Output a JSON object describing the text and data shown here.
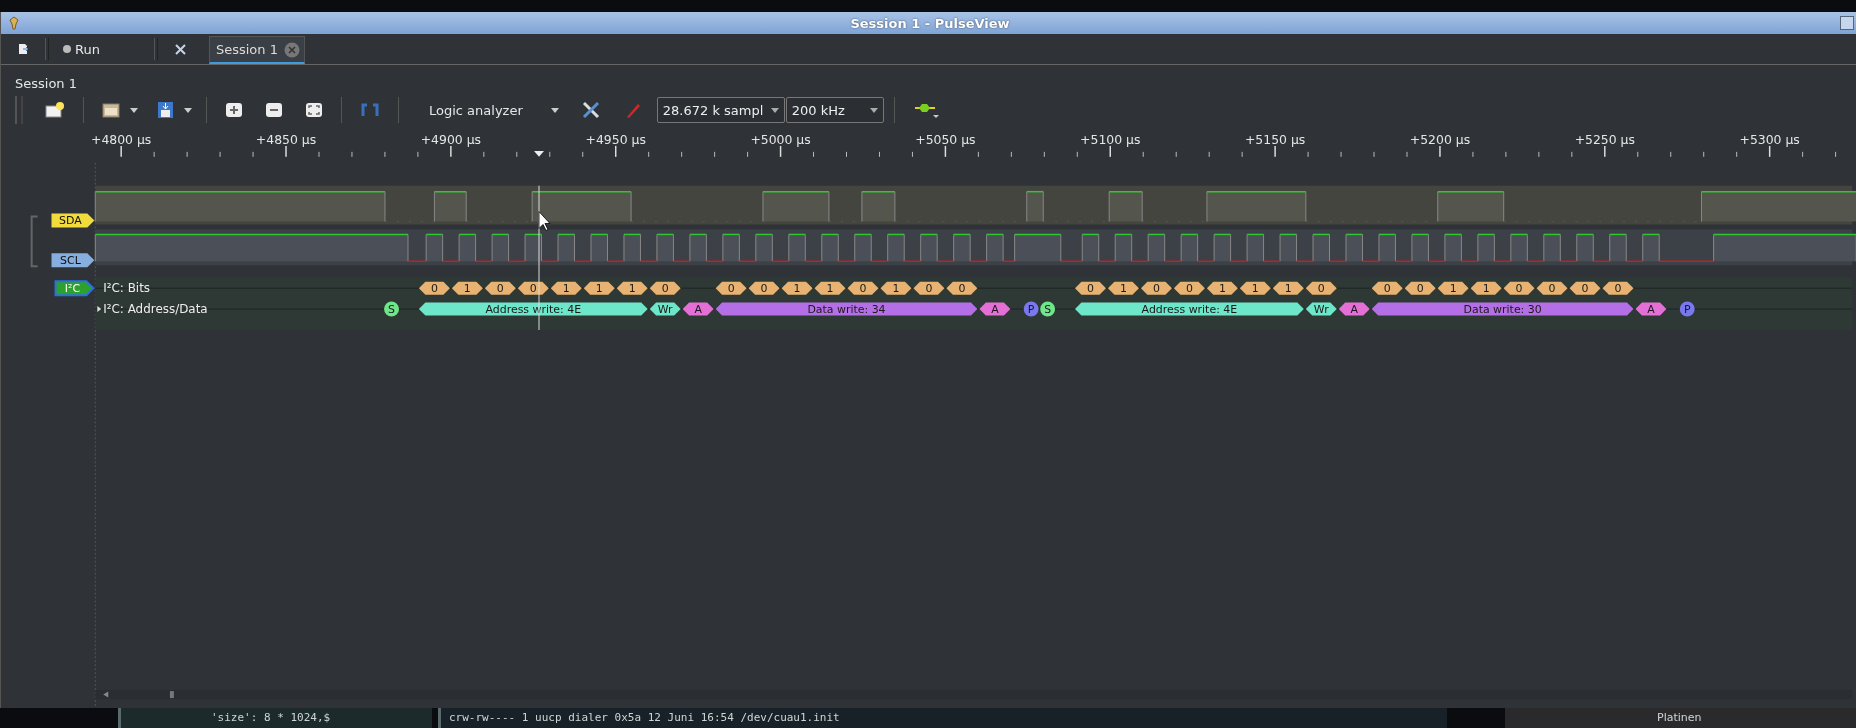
{
  "window": {
    "title": "Session 1 - PulseView"
  },
  "main_bar": {
    "run_label": "Run"
  },
  "tabs": [
    {
      "label": "Session 1",
      "selected": true
    }
  ],
  "session_label": "Session 1",
  "toolbar": {
    "device": "Logic analyzer",
    "samples": "28.672 k sampl",
    "rate": "200 kHz"
  },
  "ruler": {
    "labels": [
      "+4800 µs",
      "+4850 µs",
      "+4900 µs",
      "+4950 µs",
      "+5000 µs",
      "+5050 µs",
      "+5100 µs",
      "+5150 µs",
      "+5200 µs",
      "+5250 µs",
      "+5300 µs"
    ]
  },
  "traces": [
    {
      "name": "SDA",
      "color": "#f2dc3c"
    },
    {
      "name": "SCL",
      "color": "#86aede"
    }
  ],
  "decoder": {
    "name": "I²C",
    "rows": [
      {
        "label": "I²C: Bits",
        "expandable": false,
        "annotations": [
          {
            "text": "0",
            "kind": "bit"
          },
          {
            "text": "1",
            "kind": "bit"
          },
          {
            "text": "0",
            "kind": "bit"
          },
          {
            "text": "0",
            "kind": "bit"
          },
          {
            "text": "1",
            "kind": "bit"
          },
          {
            "text": "1",
            "kind": "bit"
          },
          {
            "text": "1",
            "kind": "bit"
          },
          {
            "text": "0",
            "kind": "bit"
          },
          {
            "text": "0",
            "kind": "bit"
          },
          {
            "text": "0",
            "kind": "bit"
          },
          {
            "text": "1",
            "kind": "bit"
          },
          {
            "text": "1",
            "kind": "bit"
          },
          {
            "text": "0",
            "kind": "bit"
          },
          {
            "text": "1",
            "kind": "bit"
          },
          {
            "text": "0",
            "kind": "bit"
          },
          {
            "text": "0",
            "kind": "bit"
          },
          {
            "text": "0",
            "kind": "bit"
          },
          {
            "text": "1",
            "kind": "bit"
          },
          {
            "text": "0",
            "kind": "bit"
          },
          {
            "text": "0",
            "kind": "bit"
          },
          {
            "text": "1",
            "kind": "bit"
          },
          {
            "text": "1",
            "kind": "bit"
          },
          {
            "text": "1",
            "kind": "bit"
          },
          {
            "text": "0",
            "kind": "bit"
          },
          {
            "text": "0",
            "kind": "bit"
          },
          {
            "text": "0",
            "kind": "bit"
          },
          {
            "text": "1",
            "kind": "bit"
          },
          {
            "text": "1",
            "kind": "bit"
          },
          {
            "text": "0",
            "kind": "bit"
          },
          {
            "text": "0",
            "kind": "bit"
          },
          {
            "text": "0",
            "kind": "bit"
          },
          {
            "text": "0",
            "kind": "bit"
          }
        ]
      },
      {
        "label": "I²C: Address/Data",
        "expandable": true,
        "annotations": [
          {
            "text": "S",
            "kind": "start"
          },
          {
            "text": "Address write: 4E",
            "kind": "address"
          },
          {
            "text": "Wr",
            "kind": "rw"
          },
          {
            "text": "A",
            "kind": "ack"
          },
          {
            "text": "Data write: 34",
            "kind": "data"
          },
          {
            "text": "A",
            "kind": "ack"
          },
          {
            "text": "P",
            "kind": "stop"
          },
          {
            "text": "S",
            "kind": "start"
          },
          {
            "text": "Address write: 4E",
            "kind": "address"
          },
          {
            "text": "Wr",
            "kind": "rw"
          },
          {
            "text": "A",
            "kind": "ack"
          },
          {
            "text": "Data write: 30",
            "kind": "data"
          },
          {
            "text": "A",
            "kind": "ack"
          },
          {
            "text": "P",
            "kind": "stop"
          }
        ]
      }
    ]
  },
  "background_windows": [
    {
      "text": "'size': 8 * 1024,$"
    },
    {
      "text": "crw-rw----  1 uucp  dialer  0x5a 12 Juni 16:54 /dev/cuau1.init"
    },
    {
      "text": "Platinen"
    }
  ]
}
